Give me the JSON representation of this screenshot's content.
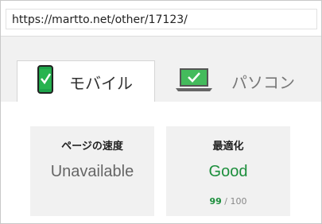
{
  "address_bar": {
    "url": "https://martto.net/other/17123/"
  },
  "tabs": [
    {
      "label": "モバイル",
      "icon": "smartphone-check-icon"
    },
    {
      "label": "パソコン",
      "icon": "laptop-check-icon"
    }
  ],
  "cards": [
    {
      "title": "ページの速度",
      "value": "Unavailable"
    },
    {
      "title": "最適化",
      "value": "Good",
      "score": "99",
      "score_suffix": "/ 100"
    }
  ],
  "colors": {
    "good_green": "#1b8e3b",
    "phone_green": "#1ea34a",
    "laptop_green": "#44bb5c"
  }
}
